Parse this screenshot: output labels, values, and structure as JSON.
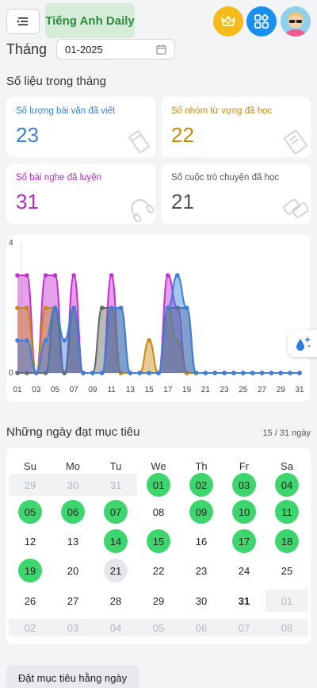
{
  "header": {
    "logo_text": "Tiếng Anh Daily"
  },
  "month": {
    "label": "Tháng",
    "value": "01-2025"
  },
  "stats": {
    "title": "Số liệu trong tháng",
    "cards": [
      {
        "label": "Số lượng bài văn đã viết",
        "value": "23",
        "color": "#3b7fd9"
      },
      {
        "label": "Số nhóm từ vựng đã học",
        "value": "22",
        "color": "#c78a10"
      },
      {
        "label": "Số bài nghe đã luyện",
        "value": "31",
        "color": "#b52ec4"
      },
      {
        "label": "Số cuộc trò chuyện đã học",
        "value": "21",
        "color": "#555555"
      }
    ]
  },
  "chart_data": {
    "type": "area",
    "x": [
      "01",
      "02",
      "03",
      "04",
      "05",
      "06",
      "07",
      "08",
      "09",
      "10",
      "11",
      "12",
      "13",
      "14",
      "15",
      "16",
      "17",
      "18",
      "19",
      "20",
      "21",
      "22",
      "23",
      "24",
      "25",
      "26",
      "27",
      "28",
      "29",
      "30",
      "31"
    ],
    "x_tick_labels": [
      "01",
      "03",
      "05",
      "07",
      "09",
      "11",
      "13",
      "15",
      "17",
      "19",
      "21",
      "23",
      "25",
      "27",
      "29",
      "31"
    ],
    "y_tick_labels": [
      "0",
      "4"
    ],
    "ylim": [
      0,
      4
    ],
    "series": [
      {
        "color": "#c32fd0",
        "values": [
          3,
          3,
          0,
          3,
          3,
          0,
          3,
          0,
          0,
          0,
          3,
          0,
          0,
          0,
          0,
          0,
          3,
          2,
          0,
          0,
          0,
          0,
          0,
          0,
          0,
          0,
          0,
          0,
          0,
          0,
          0
        ]
      },
      {
        "color": "#c98a12",
        "values": [
          2,
          2,
          0,
          2,
          2,
          0,
          2,
          0,
          0,
          0,
          2,
          0,
          0,
          0,
          1,
          0,
          2,
          1,
          0,
          0,
          0,
          0,
          0,
          0,
          0,
          0,
          0,
          0,
          0,
          0,
          0
        ]
      },
      {
        "color": "#666666",
        "values": [
          0,
          0,
          0,
          0,
          2,
          0,
          2,
          0,
          0,
          2,
          2,
          2,
          0,
          0,
          0,
          0,
          2,
          2,
          2,
          0,
          0,
          0,
          0,
          0,
          0,
          0,
          0,
          0,
          0,
          0,
          0
        ]
      },
      {
        "color": "#3b7fe0",
        "values": [
          1,
          1,
          0,
          1,
          2,
          1,
          2,
          0,
          0,
          0,
          2,
          2,
          0,
          0,
          0,
          0,
          2,
          3,
          2,
          0,
          0,
          0,
          0,
          0,
          0,
          0,
          0,
          0,
          0,
          0,
          0
        ]
      }
    ]
  },
  "goals": {
    "title": "Những ngày đạt mục tiêu",
    "count": "15 / 31 ngày",
    "weekdays": [
      "Su",
      "Mo",
      "Tu",
      "We",
      "Th",
      "Fr",
      "Sa"
    ],
    "weeks": [
      [
        {
          "d": "29",
          "s": "out"
        },
        {
          "d": "30",
          "s": "out"
        },
        {
          "d": "31",
          "s": "out"
        },
        {
          "d": "01",
          "s": "done"
        },
        {
          "d": "02",
          "s": "done"
        },
        {
          "d": "03",
          "s": "done"
        },
        {
          "d": "04",
          "s": "done"
        }
      ],
      [
        {
          "d": "05",
          "s": "done"
        },
        {
          "d": "06",
          "s": "done"
        },
        {
          "d": "07",
          "s": "done"
        },
        {
          "d": "08",
          "s": ""
        },
        {
          "d": "09",
          "s": "done"
        },
        {
          "d": "10",
          "s": "done"
        },
        {
          "d": "11",
          "s": "done"
        }
      ],
      [
        {
          "d": "12",
          "s": ""
        },
        {
          "d": "13",
          "s": ""
        },
        {
          "d": "14",
          "s": "done"
        },
        {
          "d": "15",
          "s": "done"
        },
        {
          "d": "16",
          "s": ""
        },
        {
          "d": "17",
          "s": "done"
        },
        {
          "d": "18",
          "s": "done"
        }
      ],
      [
        {
          "d": "19",
          "s": "done"
        },
        {
          "d": "20",
          "s": ""
        },
        {
          "d": "21",
          "s": "today"
        },
        {
          "d": "22",
          "s": ""
        },
        {
          "d": "23",
          "s": ""
        },
        {
          "d": "24",
          "s": ""
        },
        {
          "d": "25",
          "s": ""
        }
      ],
      [
        {
          "d": "26",
          "s": ""
        },
        {
          "d": "27",
          "s": ""
        },
        {
          "d": "28",
          "s": ""
        },
        {
          "d": "29",
          "s": ""
        },
        {
          "d": "30",
          "s": ""
        },
        {
          "d": "31",
          "s": "bold"
        },
        {
          "d": "01",
          "s": "out"
        }
      ],
      [
        {
          "d": "02",
          "s": "out"
        },
        {
          "d": "03",
          "s": "out"
        },
        {
          "d": "04",
          "s": "out"
        },
        {
          "d": "05",
          "s": "out"
        },
        {
          "d": "06",
          "s": "out"
        },
        {
          "d": "07",
          "s": "out"
        },
        {
          "d": "08",
          "s": "out"
        }
      ]
    ]
  },
  "actions": {
    "set_goal_label": "Đặt mục tiêu hằng ngày"
  }
}
